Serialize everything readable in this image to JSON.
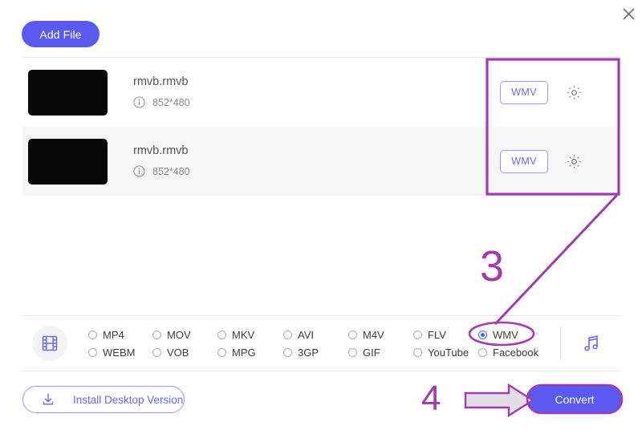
{
  "window": {
    "close_label": "×",
    "close_icon": "close-icon"
  },
  "toolbar": {
    "add_file_label": "Add File"
  },
  "file_list": {
    "rows": [
      {
        "name": "rmvb.rmvb",
        "dimensions": "852*480",
        "info_icon": "info-icon",
        "format_badge": "WMV",
        "settings_icon": "gear-icon",
        "thumbnail": "video-thumbnail"
      },
      {
        "name": "rmvb.rmvb",
        "dimensions": "852*480",
        "info_icon": "info-icon",
        "format_badge": "WMV",
        "settings_icon": "gear-icon",
        "thumbnail": "video-thumbnail"
      }
    ]
  },
  "format_panel": {
    "video_icon": "film-strip-icon",
    "audio_icon": "music-note-icon",
    "selected": "WMV",
    "options": [
      {
        "label": "MP4",
        "selected": false
      },
      {
        "label": "MOV",
        "selected": false
      },
      {
        "label": "MKV",
        "selected": false
      },
      {
        "label": "AVI",
        "selected": false
      },
      {
        "label": "M4V",
        "selected": false
      },
      {
        "label": "FLV",
        "selected": false
      },
      {
        "label": "WMV",
        "selected": true
      },
      {
        "label": "WEBM",
        "selected": false
      },
      {
        "label": "VOB",
        "selected": false
      },
      {
        "label": "MPG",
        "selected": false
      },
      {
        "label": "3GP",
        "selected": false
      },
      {
        "label": "GIF",
        "selected": false
      },
      {
        "label": "YouTube",
        "selected": false
      },
      {
        "label": "Facebook",
        "selected": false
      }
    ]
  },
  "footer": {
    "install_label": "Install Desktop Version",
    "install_icon": "download-icon",
    "convert_label": "Convert"
  },
  "annotations": {
    "step3": "3",
    "step4": "4",
    "accent_color": "#a13cac",
    "arrow_fill": "#e0dde6"
  },
  "colors": {
    "primary": "#5a5af0",
    "badge_border": "#9a9af2",
    "row_alt_bg": "#f6f6f7",
    "divider": "#e9e9ec",
    "annotation": "#a13cac"
  }
}
